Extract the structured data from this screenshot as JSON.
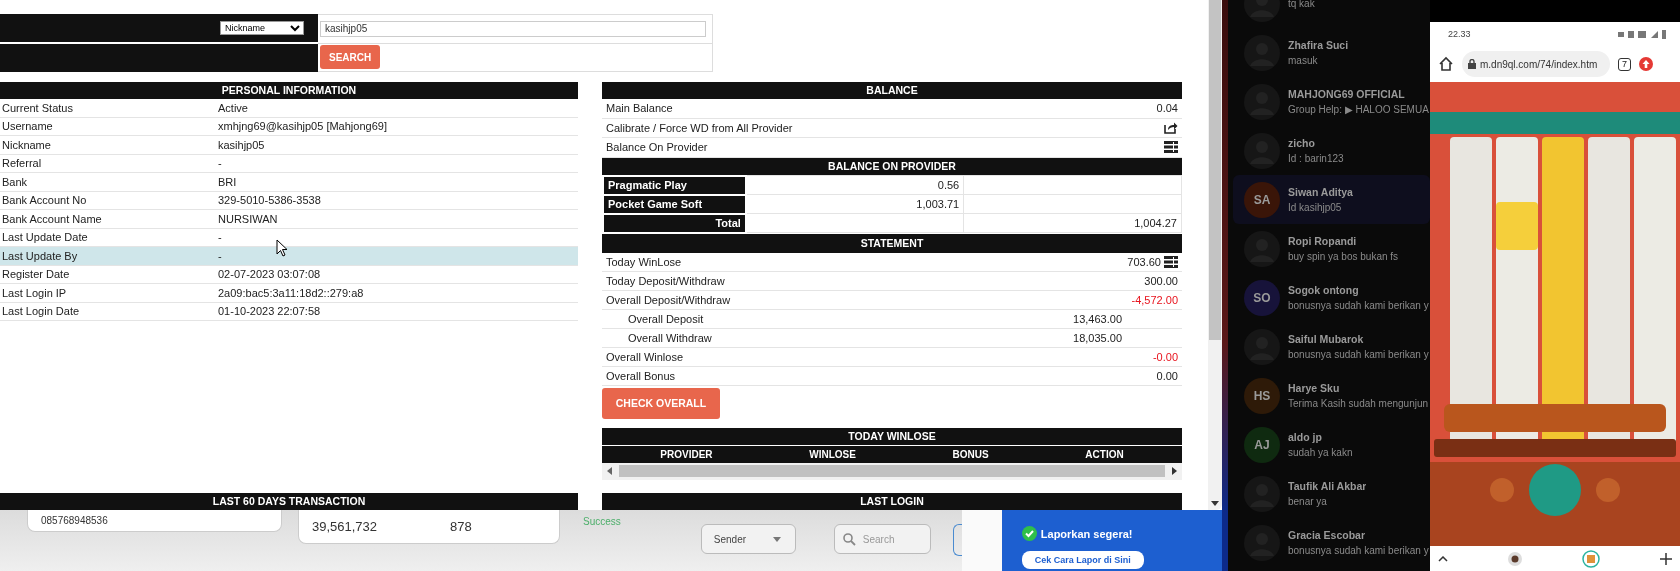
{
  "search": {
    "field_option": "Nickname",
    "value": "kasihjp05",
    "button": "SEARCH"
  },
  "personal_information": {
    "title": "PERSONAL INFORMATION",
    "rows": [
      {
        "label": "Current Status",
        "value": "Active",
        "highlighted": false
      },
      {
        "label": "Username",
        "value": "xmhjng69@kasihjp05  [Mahjong69]",
        "highlighted": false
      },
      {
        "label": "Nickname",
        "value": "kasihjp05",
        "highlighted": false
      },
      {
        "label": "Referral",
        "value": "-",
        "highlighted": false
      },
      {
        "label": "Bank",
        "value": "BRI",
        "highlighted": false
      },
      {
        "label": "Bank Account No",
        "value": "329-5010-5386-3538",
        "highlighted": false
      },
      {
        "label": "Bank Account Name",
        "value": "NURSIWAN",
        "highlighted": false
      },
      {
        "label": "Last Update Date",
        "value": "-",
        "highlighted": false
      },
      {
        "label": "Last Update By",
        "value": "-",
        "highlighted": true
      },
      {
        "label": "Register Date",
        "value": "02-07-2023 03:07:08",
        "highlighted": false
      },
      {
        "label": "Last Login IP",
        "value": "2a09:bac5:3a11:18d2::279:a8",
        "highlighted": false
      },
      {
        "label": "Last Login Date",
        "value": "01-10-2023 22:07:58",
        "highlighted": false
      }
    ]
  },
  "balance": {
    "title": "BALANCE",
    "rows": [
      {
        "kind": "value",
        "label": "Main Balance",
        "value": "0.04"
      },
      {
        "kind": "action",
        "label": "Calibrate / Force WD from All Provider"
      },
      {
        "kind": "list",
        "label": "Balance On Provider"
      }
    ]
  },
  "balance_on_provider": {
    "title": "BALANCE ON PROVIDER",
    "rows": [
      {
        "provider": "Pragmatic Play",
        "balance": "0.56"
      },
      {
        "provider": "Pocket Game Soft",
        "balance": "1,003.71"
      }
    ],
    "total_label": "Total",
    "total": "1,004.27"
  },
  "statement": {
    "title": "STATEMENT",
    "rows": [
      {
        "kind": "detail",
        "label": "Today WinLose",
        "value": "703.60",
        "negative": false
      },
      {
        "kind": "main",
        "label": "Today Deposit/Withdraw",
        "value": "300.00",
        "negative": false
      },
      {
        "kind": "main",
        "label": "Overall Deposit/Withdraw",
        "value": "-4,572.00",
        "negative": true
      },
      {
        "kind": "sub",
        "label": "Overall Deposit",
        "value": "13,463.00",
        "negative": false
      },
      {
        "kind": "sub",
        "label": "Overall Withdraw",
        "value": "18,035.00",
        "negative": false
      },
      {
        "kind": "main",
        "label": "Overall Winlose",
        "value": "-0.00",
        "negative": true
      },
      {
        "kind": "main",
        "label": "Overall Bonus",
        "value": "0.00",
        "negative": false
      }
    ]
  },
  "check_overall_button": "CHECK OVERALL",
  "today_winlose": {
    "title": "TODAY WINLOSE",
    "columns": [
      "PROVIDER",
      "WINLOSE",
      "BONUS",
      "ACTION"
    ]
  },
  "last_60_days": {
    "title": "LAST 60 DAYS TRANSACTION"
  },
  "last_login": {
    "title": "LAST LOGIN"
  },
  "background_page": {
    "phone_field": "085768948536",
    "amount": "39,561,732",
    "count": "878",
    "status": "Success",
    "sender_select": "Sender",
    "search_placeholder": "Search",
    "report_option": "Laporkan segera!",
    "report_button": "Cek Cara Lapor di Sini"
  },
  "chat_list": [
    {
      "message": "tq kak",
      "selected": false
    },
    {
      "name": "Zhafira Suci",
      "message": "masuk",
      "selected": false
    },
    {
      "name": "MAHJONG69 OFFICIAL",
      "message": "Group Help: ▶ HALOO SEMUA",
      "selected": false
    },
    {
      "name": "zicho",
      "message": "Id : barin123",
      "selected": false
    },
    {
      "name": "Siwan Aditya",
      "message": "Id kasihjp05",
      "initials": "SA",
      "color": "#3a1508",
      "selected": true
    },
    {
      "name": "Ropi Ropandi",
      "message": "buy spin ya bos bukan fs",
      "selected": false
    },
    {
      "name": "Sogok ontong",
      "message": "bonusnya sudah kami berikan y",
      "initials": "SO",
      "color": "#17133a",
      "selected": false
    },
    {
      "name": "Saiful Mubarok",
      "message": "bonusnya sudah kami berikan y",
      "selected": false
    },
    {
      "name": "Harye Sku",
      "message": "Terima Kasih sudah mengunjun",
      "initials": "HS",
      "color": "#2e1a08",
      "selected": false
    },
    {
      "name": "aldo jp",
      "message": "sudah ya kakn",
      "initials": "AJ",
      "color": "#0f2a10",
      "selected": false
    },
    {
      "name": "Taufik Ali Akbar",
      "message": "benar ya",
      "selected": false
    },
    {
      "name": "Gracia Escobar",
      "message": "bonusnya sudah kami berikan y",
      "selected": false
    }
  ],
  "phone": {
    "time": "22.33",
    "url": "m.dn9ql.com/74/index.htm",
    "tab_count": "7"
  }
}
